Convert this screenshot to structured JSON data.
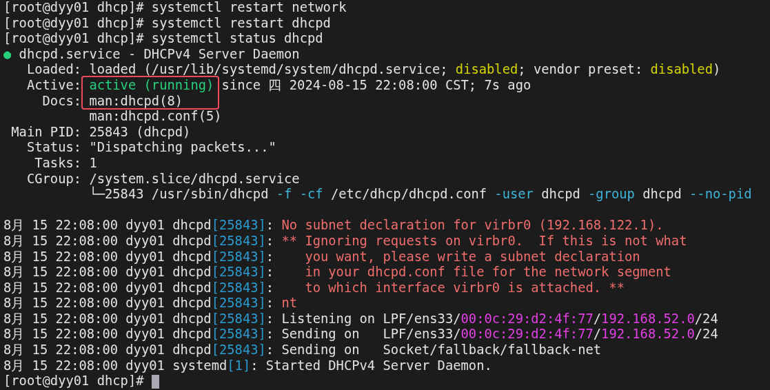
{
  "terminal": {
    "lines": [
      {
        "kind": "text",
        "segments": [
          {
            "kind": "plain",
            "text": "[root@dyy01 dhcp]# systemctl restart network"
          }
        ]
      },
      {
        "kind": "text",
        "segments": [
          {
            "kind": "plain",
            "text": "[root@dyy01 dhcp]# systemctl restart dhcpd"
          }
        ]
      },
      {
        "kind": "text",
        "segments": [
          {
            "kind": "plain",
            "text": "[root@dyy01 dhcp]# systemctl status dhcpd"
          }
        ]
      },
      {
        "kind": "text",
        "segments": [
          {
            "kind": "green",
            "text": "●"
          },
          {
            "kind": "plain",
            "text": " dhcpd.service - DHCPv4 Server Daemon"
          }
        ]
      },
      {
        "kind": "text",
        "segments": [
          {
            "kind": "plain",
            "text": "   Loaded: loaded (/usr/lib/systemd/system/dhcpd.service; "
          },
          {
            "kind": "yellow",
            "text": "disabled"
          },
          {
            "kind": "plain",
            "text": "; vendor preset: "
          },
          {
            "kind": "yellow",
            "text": "disabled"
          },
          {
            "kind": "plain",
            "text": ")"
          }
        ]
      },
      {
        "kind": "text",
        "segments": [
          {
            "kind": "plain",
            "text": "   Active: "
          },
          {
            "kind": "green",
            "text": "active (running)"
          },
          {
            "kind": "plain",
            "text": " since 四 2024-08-15 22:08:00 CST; 7s ago"
          }
        ]
      },
      {
        "kind": "text",
        "segments": [
          {
            "kind": "plain",
            "text": "     Docs: man:dhcpd(8)"
          }
        ]
      },
      {
        "kind": "text",
        "segments": [
          {
            "kind": "plain",
            "text": "           man:dhcpd.conf(5)"
          }
        ]
      },
      {
        "kind": "text",
        "segments": [
          {
            "kind": "plain",
            "text": " Main PID: 25843 (dhcpd)"
          }
        ]
      },
      {
        "kind": "text",
        "segments": [
          {
            "kind": "plain",
            "text": "   Status: \"Dispatching packets...\""
          }
        ]
      },
      {
        "kind": "text",
        "segments": [
          {
            "kind": "plain",
            "text": "    Tasks: 1"
          }
        ]
      },
      {
        "kind": "text",
        "segments": [
          {
            "kind": "plain",
            "text": "   CGroup: /system.slice/dhcpd.service"
          }
        ]
      },
      {
        "kind": "text",
        "segments": [
          {
            "kind": "plain",
            "text": "           └─25843 /usr/sbin/dhcpd"
          },
          {
            "kind": "cyan",
            "text": " -f"
          },
          {
            "kind": "cyan",
            "text": " -cf"
          },
          {
            "kind": "plain",
            "text": " /etc/dhcp/dhcpd.conf"
          },
          {
            "kind": "cyan",
            "text": " -user"
          },
          {
            "kind": "plain",
            "text": " dhcpd"
          },
          {
            "kind": "cyan",
            "text": " -group"
          },
          {
            "kind": "plain",
            "text": " dhcpd"
          },
          {
            "kind": "cyan",
            "text": " --no-pid"
          }
        ]
      },
      {
        "kind": "blank"
      },
      {
        "kind": "text",
        "segments": [
          {
            "kind": "plain",
            "text": "8月 15 22:08:00 dyy01 dhcpd"
          },
          {
            "kind": "blue",
            "text": "[25843]"
          },
          {
            "kind": "plain",
            "text": ": "
          },
          {
            "kind": "red",
            "text": "No subnet declaration for virbr0 (192.168.122.1)."
          }
        ]
      },
      {
        "kind": "text",
        "segments": [
          {
            "kind": "plain",
            "text": "8月 15 22:08:00 dyy01 dhcpd"
          },
          {
            "kind": "blue",
            "text": "[25843]"
          },
          {
            "kind": "plain",
            "text": ": "
          },
          {
            "kind": "red",
            "text": "** Ignoring requests on virbr0.  If this is not what"
          }
        ]
      },
      {
        "kind": "text",
        "segments": [
          {
            "kind": "plain",
            "text": "8月 15 22:08:00 dyy01 dhcpd"
          },
          {
            "kind": "blue",
            "text": "[25843]"
          },
          {
            "kind": "plain",
            "text": ":    "
          },
          {
            "kind": "red",
            "text": "you want, please write a subnet declaration"
          }
        ]
      },
      {
        "kind": "text",
        "segments": [
          {
            "kind": "plain",
            "text": "8月 15 22:08:00 dyy01 dhcpd"
          },
          {
            "kind": "blue",
            "text": "[25843]"
          },
          {
            "kind": "plain",
            "text": ":    "
          },
          {
            "kind": "red",
            "text": "in your dhcpd.conf file for the network segment"
          }
        ]
      },
      {
        "kind": "text",
        "segments": [
          {
            "kind": "plain",
            "text": "8月 15 22:08:00 dyy01 dhcpd"
          },
          {
            "kind": "blue",
            "text": "[25843]"
          },
          {
            "kind": "plain",
            "text": ":    "
          },
          {
            "kind": "red",
            "text": "to which interface virbr0 is attached. **"
          }
        ]
      },
      {
        "kind": "text",
        "segments": [
          {
            "kind": "plain",
            "text": "8月 15 22:08:00 dyy01 dhcpd"
          },
          {
            "kind": "blue",
            "text": "[25843]"
          },
          {
            "kind": "plain",
            "text": ": "
          },
          {
            "kind": "red",
            "text": "nt"
          }
        ]
      },
      {
        "kind": "text",
        "segments": [
          {
            "kind": "plain",
            "text": "8月 15 22:08:00 dyy01 dhcpd"
          },
          {
            "kind": "blue",
            "text": "[25843]"
          },
          {
            "kind": "plain",
            "text": ": Listening on LPF/ens33/"
          },
          {
            "kind": "magenta",
            "text": "00:0c:29:d2:4f:77"
          },
          {
            "kind": "plain",
            "text": "/"
          },
          {
            "kind": "magenta",
            "text": "192.168.52.0"
          },
          {
            "kind": "plain",
            "text": "/24"
          }
        ]
      },
      {
        "kind": "text",
        "segments": [
          {
            "kind": "plain",
            "text": "8月 15 22:08:00 dyy01 dhcpd"
          },
          {
            "kind": "blue",
            "text": "[25843]"
          },
          {
            "kind": "plain",
            "text": ": Sending on   LPF/ens33/"
          },
          {
            "kind": "magenta",
            "text": "00:0c:29:d2:4f:77"
          },
          {
            "kind": "plain",
            "text": "/"
          },
          {
            "kind": "magenta",
            "text": "192.168.52.0"
          },
          {
            "kind": "plain",
            "text": "/24"
          }
        ]
      },
      {
        "kind": "text",
        "segments": [
          {
            "kind": "plain",
            "text": "8月 15 22:08:00 dyy01 dhcpd"
          },
          {
            "kind": "blue",
            "text": "[25843]"
          },
          {
            "kind": "plain",
            "text": ": Sending on   Socket/fallback/fallback-net"
          }
        ]
      },
      {
        "kind": "text",
        "segments": [
          {
            "kind": "plain",
            "text": "8月 15 22:08:00 dyy01 systemd"
          },
          {
            "kind": "blue",
            "text": "[1]"
          },
          {
            "kind": "plain",
            "text": ": Started DHCPv4 Server Daemon."
          }
        ]
      },
      {
        "kind": "prompt",
        "segments": [
          {
            "kind": "plain",
            "text": "[root@dyy01 dhcp]# "
          }
        ]
      }
    ]
  }
}
